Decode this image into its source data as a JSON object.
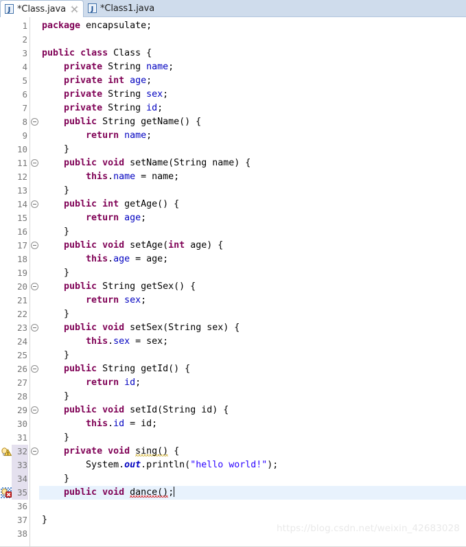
{
  "window": {
    "app": "Eclipse Java Editor",
    "accent_color": "#cfdcec",
    "keyword_color": "#7f0055",
    "field_color": "#0000c0",
    "string_color": "#2a00ff",
    "current_line_color": "#e8f2fd"
  },
  "tabs": [
    {
      "label": "*Class.java",
      "icon": "java-file-icon",
      "active": true,
      "dirty": true,
      "close_glyph": "⌧"
    },
    {
      "label": "*Class1.java",
      "icon": "java-file-icon",
      "active": false,
      "dirty": true
    }
  ],
  "gutter": {
    "first_line": 1,
    "last_line": 38,
    "fold_lines": [
      8,
      11,
      14,
      17,
      20,
      23,
      26,
      29,
      32
    ],
    "fold_glyph": "⊖",
    "highlighted_number_lines": [
      32,
      33,
      34,
      35
    ],
    "markers": [
      {
        "line": 32,
        "type": "warning-quickfix-icon",
        "title": "warning"
      },
      {
        "line": 35,
        "type": "error-quickfix-icon",
        "title": "error"
      }
    ]
  },
  "editor": {
    "current_line": 35,
    "caret_line": 35,
    "caret_column": 25,
    "lines": [
      {
        "n": 1,
        "tokens": [
          {
            "t": "package",
            "c": "kw"
          },
          {
            "t": " encapsulate;",
            "c": "plain"
          }
        ]
      },
      {
        "n": 2,
        "tokens": []
      },
      {
        "n": 3,
        "tokens": [
          {
            "t": "public",
            "c": "kw"
          },
          {
            "t": " ",
            "c": "plain"
          },
          {
            "t": "class",
            "c": "kw"
          },
          {
            "t": " Class {",
            "c": "plain"
          }
        ]
      },
      {
        "n": 4,
        "tokens": [
          {
            "t": "    ",
            "c": "plain"
          },
          {
            "t": "private",
            "c": "kw"
          },
          {
            "t": " String ",
            "c": "plain"
          },
          {
            "t": "name",
            "c": "fld"
          },
          {
            "t": ";",
            "c": "plain"
          }
        ]
      },
      {
        "n": 5,
        "tokens": [
          {
            "t": "    ",
            "c": "plain"
          },
          {
            "t": "private",
            "c": "kw"
          },
          {
            "t": " ",
            "c": "plain"
          },
          {
            "t": "int",
            "c": "kw"
          },
          {
            "t": " ",
            "c": "plain"
          },
          {
            "t": "age",
            "c": "fld"
          },
          {
            "t": ";",
            "c": "plain"
          }
        ]
      },
      {
        "n": 6,
        "tokens": [
          {
            "t": "    ",
            "c": "plain"
          },
          {
            "t": "private",
            "c": "kw"
          },
          {
            "t": " String ",
            "c": "plain"
          },
          {
            "t": "sex",
            "c": "fld"
          },
          {
            "t": ";",
            "c": "plain"
          }
        ]
      },
      {
        "n": 7,
        "tokens": [
          {
            "t": "    ",
            "c": "plain"
          },
          {
            "t": "private",
            "c": "kw"
          },
          {
            "t": " String ",
            "c": "plain"
          },
          {
            "t": "id",
            "c": "fld"
          },
          {
            "t": ";",
            "c": "plain"
          }
        ]
      },
      {
        "n": 8,
        "tokens": [
          {
            "t": "    ",
            "c": "plain"
          },
          {
            "t": "public",
            "c": "kw"
          },
          {
            "t": " String getName() {",
            "c": "plain"
          }
        ]
      },
      {
        "n": 9,
        "tokens": [
          {
            "t": "        ",
            "c": "plain"
          },
          {
            "t": "return",
            "c": "kw"
          },
          {
            "t": " ",
            "c": "plain"
          },
          {
            "t": "name",
            "c": "fld"
          },
          {
            "t": ";",
            "c": "plain"
          }
        ]
      },
      {
        "n": 10,
        "tokens": [
          {
            "t": "    }",
            "c": "plain"
          }
        ]
      },
      {
        "n": 11,
        "tokens": [
          {
            "t": "    ",
            "c": "plain"
          },
          {
            "t": "public",
            "c": "kw"
          },
          {
            "t": " ",
            "c": "plain"
          },
          {
            "t": "void",
            "c": "kw"
          },
          {
            "t": " setName(String name) {",
            "c": "plain"
          }
        ]
      },
      {
        "n": 12,
        "tokens": [
          {
            "t": "        ",
            "c": "plain"
          },
          {
            "t": "this",
            "c": "kw"
          },
          {
            "t": ".",
            "c": "plain"
          },
          {
            "t": "name",
            "c": "fld"
          },
          {
            "t": " = name;",
            "c": "plain"
          }
        ]
      },
      {
        "n": 13,
        "tokens": [
          {
            "t": "    }",
            "c": "plain"
          }
        ]
      },
      {
        "n": 14,
        "tokens": [
          {
            "t": "    ",
            "c": "plain"
          },
          {
            "t": "public",
            "c": "kw"
          },
          {
            "t": " ",
            "c": "plain"
          },
          {
            "t": "int",
            "c": "kw"
          },
          {
            "t": " getAge() {",
            "c": "plain"
          }
        ]
      },
      {
        "n": 15,
        "tokens": [
          {
            "t": "        ",
            "c": "plain"
          },
          {
            "t": "return",
            "c": "kw"
          },
          {
            "t": " ",
            "c": "plain"
          },
          {
            "t": "age",
            "c": "fld"
          },
          {
            "t": ";",
            "c": "plain"
          }
        ]
      },
      {
        "n": 16,
        "tokens": [
          {
            "t": "    }",
            "c": "plain"
          }
        ]
      },
      {
        "n": 17,
        "tokens": [
          {
            "t": "    ",
            "c": "plain"
          },
          {
            "t": "public",
            "c": "kw"
          },
          {
            "t": " ",
            "c": "plain"
          },
          {
            "t": "void",
            "c": "kw"
          },
          {
            "t": " setAge(",
            "c": "plain"
          },
          {
            "t": "int",
            "c": "kw"
          },
          {
            "t": " age) {",
            "c": "plain"
          }
        ]
      },
      {
        "n": 18,
        "tokens": [
          {
            "t": "        ",
            "c": "plain"
          },
          {
            "t": "this",
            "c": "kw"
          },
          {
            "t": ".",
            "c": "plain"
          },
          {
            "t": "age",
            "c": "fld"
          },
          {
            "t": " = age;",
            "c": "plain"
          }
        ]
      },
      {
        "n": 19,
        "tokens": [
          {
            "t": "    }",
            "c": "plain"
          }
        ]
      },
      {
        "n": 20,
        "tokens": [
          {
            "t": "    ",
            "c": "plain"
          },
          {
            "t": "public",
            "c": "kw"
          },
          {
            "t": " String getSex() {",
            "c": "plain"
          }
        ]
      },
      {
        "n": 21,
        "tokens": [
          {
            "t": "        ",
            "c": "plain"
          },
          {
            "t": "return",
            "c": "kw"
          },
          {
            "t": " ",
            "c": "plain"
          },
          {
            "t": "sex",
            "c": "fld"
          },
          {
            "t": ";",
            "c": "plain"
          }
        ]
      },
      {
        "n": 22,
        "tokens": [
          {
            "t": "    }",
            "c": "plain"
          }
        ]
      },
      {
        "n": 23,
        "tokens": [
          {
            "t": "    ",
            "c": "plain"
          },
          {
            "t": "public",
            "c": "kw"
          },
          {
            "t": " ",
            "c": "plain"
          },
          {
            "t": "void",
            "c": "kw"
          },
          {
            "t": " setSex(String sex) {",
            "c": "plain"
          }
        ]
      },
      {
        "n": 24,
        "tokens": [
          {
            "t": "        ",
            "c": "plain"
          },
          {
            "t": "this",
            "c": "kw"
          },
          {
            "t": ".",
            "c": "plain"
          },
          {
            "t": "sex",
            "c": "fld"
          },
          {
            "t": " = sex;",
            "c": "plain"
          }
        ]
      },
      {
        "n": 25,
        "tokens": [
          {
            "t": "    }",
            "c": "plain"
          }
        ]
      },
      {
        "n": 26,
        "tokens": [
          {
            "t": "    ",
            "c": "plain"
          },
          {
            "t": "public",
            "c": "kw"
          },
          {
            "t": " String getId() {",
            "c": "plain"
          }
        ]
      },
      {
        "n": 27,
        "tokens": [
          {
            "t": "        ",
            "c": "plain"
          },
          {
            "t": "return",
            "c": "kw"
          },
          {
            "t": " ",
            "c": "plain"
          },
          {
            "t": "id",
            "c": "fld"
          },
          {
            "t": ";",
            "c": "plain"
          }
        ]
      },
      {
        "n": 28,
        "tokens": [
          {
            "t": "    }",
            "c": "plain"
          }
        ]
      },
      {
        "n": 29,
        "tokens": [
          {
            "t": "    ",
            "c": "plain"
          },
          {
            "t": "public",
            "c": "kw"
          },
          {
            "t": " ",
            "c": "plain"
          },
          {
            "t": "void",
            "c": "kw"
          },
          {
            "t": " setId(String id) {",
            "c": "plain"
          }
        ]
      },
      {
        "n": 30,
        "tokens": [
          {
            "t": "        ",
            "c": "plain"
          },
          {
            "t": "this",
            "c": "kw"
          },
          {
            "t": ".",
            "c": "plain"
          },
          {
            "t": "id",
            "c": "fld"
          },
          {
            "t": " = id;",
            "c": "plain"
          }
        ]
      },
      {
        "n": 31,
        "tokens": [
          {
            "t": "    }",
            "c": "plain"
          }
        ]
      },
      {
        "n": 32,
        "tokens": [
          {
            "t": "    ",
            "c": "plain"
          },
          {
            "t": "private",
            "c": "kw"
          },
          {
            "t": " ",
            "c": "plain"
          },
          {
            "t": "void",
            "c": "kw"
          },
          {
            "t": " ",
            "c": "plain"
          },
          {
            "t": "sing()",
            "c": "plain",
            "u": "warn"
          },
          {
            "t": " {",
            "c": "plain"
          }
        ]
      },
      {
        "n": 33,
        "tokens": [
          {
            "t": "        System.",
            "c": "plain"
          },
          {
            "t": "out",
            "c": "sfld"
          },
          {
            "t": ".println(",
            "c": "plain"
          },
          {
            "t": "\"hello world!\"",
            "c": "str"
          },
          {
            "t": ");",
            "c": "plain"
          }
        ]
      },
      {
        "n": 34,
        "tokens": [
          {
            "t": "    }",
            "c": "plain"
          }
        ]
      },
      {
        "n": 35,
        "tokens": [
          {
            "t": "    ",
            "c": "plain"
          },
          {
            "t": "public",
            "c": "kw"
          },
          {
            "t": " ",
            "c": "plain"
          },
          {
            "t": "void",
            "c": "kw"
          },
          {
            "t": " ",
            "c": "plain"
          },
          {
            "t": "dance()",
            "c": "plain",
            "u": "err"
          },
          {
            "t": ";",
            "c": "plain"
          }
        ],
        "caret": true
      },
      {
        "n": 36,
        "tokens": []
      },
      {
        "n": 37,
        "tokens": [
          {
            "t": "}",
            "c": "plain"
          }
        ]
      },
      {
        "n": 38,
        "tokens": []
      }
    ]
  },
  "watermark": {
    "text": "https://blog.csdn.net/weixin_42683028"
  }
}
